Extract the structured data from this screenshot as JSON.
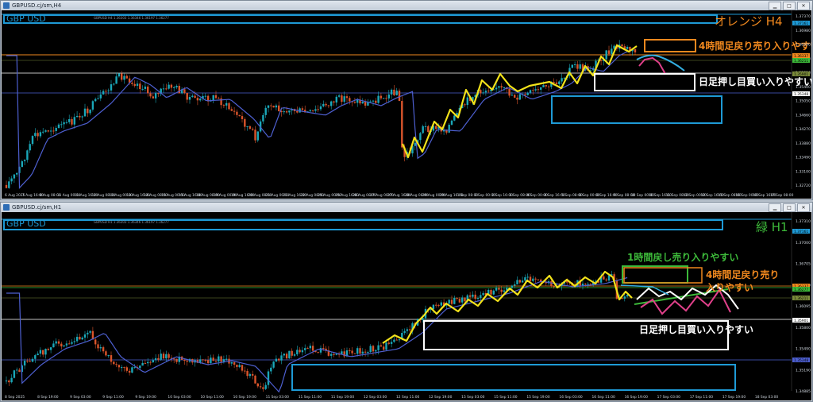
{
  "top": {
    "window_title": "GBPUSD.cj/sm,H4",
    "symbol_label": "GBP USD",
    "tf_label": "オレンジ H4",
    "header_info": "GBPUSD H4 1.36303 1.36346 1.36197 1.36277",
    "annotations": {
      "sell_text": "4時間足戻り売り入りやすい",
      "buy_text": "日足押し目買い入りやすい"
    },
    "prices": [
      "1.37370",
      "1.36980",
      "1.36590",
      "1.36200",
      "1.35810",
      "1.35400",
      "1.35050",
      "1.34660",
      "1.34270",
      "1.33880",
      "1.33490",
      "1.33100",
      "1.32720"
    ],
    "price_badges": [
      "1.37161",
      "1.36337",
      "1.36211",
      "1.35901",
      "1.35348"
    ],
    "times": [
      "6 Aug 2025",
      "7 Aug 16:00",
      "8 Aug 08:00",
      "11 Aug 00:00",
      "11 Aug 16:00",
      "12 Aug 08:00",
      "13 Aug 00:00",
      "13 Aug 16:00",
      "14 Aug 08:00",
      "15 Aug 00:00",
      "15 Aug 16:00",
      "18 Aug 08:00",
      "19 Aug 00:00",
      "19 Aug 16:00",
      "20 Aug 08:00",
      "21 Aug 00:00",
      "21 Aug 16:00",
      "22 Aug 08:00",
      "25 Aug 00:00",
      "25 Aug 16:00",
      "26 Aug 08:00",
      "27 Aug 00:00",
      "27 Aug 16:00",
      "28 Aug 08:00",
      "29 Aug 00:00",
      "29 Aug 16:00",
      "1 Sep 08:00",
      "2 Sep 00:00",
      "2 Sep 16:00",
      "3 Sep 08:00",
      "4 Sep 00:00",
      "4 Sep 16:00",
      "5 Sep 08:00",
      "8 Sep 00:00",
      "8 Sep 16:00",
      "9 Sep 08:00",
      "10 Sep 00:00",
      "10 Sep 16:00",
      "11 Sep 08:00",
      "12 Sep 00:00",
      "12 Sep 16:00",
      "15 Sep 08:00",
      "16 Sep 00:00",
      "16 Sep 16:00",
      "17 Sep 08:00"
    ]
  },
  "bottom": {
    "window_title": "GBPUSD.cj/sm,H1",
    "symbol_label": "GBP USD",
    "tf_label": "緑 H1",
    "header_info": "GBPUSD H1 1.36303 1.36346 1.36197 1.36277",
    "annotations": {
      "sell_h1_text": "1時間戻し売り入りやすい",
      "sell_h4_text_line1": "4時間足戻り売り",
      "sell_h4_text_line2": "入りやすい",
      "buy_text": "日足押し目買い入りやすい"
    },
    "prices": [
      "1.37310",
      "1.37000",
      "1.36705",
      "1.36400",
      "1.36095",
      "1.35800",
      "1.35490",
      "1.35190",
      "1.34885"
    ],
    "price_badges": [
      "1.37161",
      "1.36337",
      "1.36277",
      "1.36211",
      "1.35901",
      "1.35348"
    ],
    "times": [
      "8 Sep 2025",
      "8 Sep 19:00",
      "9 Sep 03:00",
      "9 Sep 11:00",
      "9 Sep 19:00",
      "10 Sep 03:00",
      "10 Sep 11:00",
      "10 Sep 19:00",
      "11 Sep 03:00",
      "11 Sep 11:00",
      "11 Sep 19:00",
      "12 Sep 03:00",
      "12 Sep 11:00",
      "12 Sep 19:00",
      "15 Sep 03:00",
      "15 Sep 11:00",
      "15 Sep 19:00",
      "16 Sep 03:00",
      "16 Sep 11:00",
      "16 Sep 19:00",
      "17 Sep 03:00",
      "17 Sep 11:00",
      "17 Sep 19:00",
      "18 Sep 03:00"
    ]
  },
  "colors": {
    "bull": "#1aa7b8",
    "bear": "#d9542b",
    "ma": "#4d5fd0",
    "zigzag": "#f2e21a",
    "blue_box": "#1e9ad6",
    "orange": "#f0881e",
    "green": "#3dba3a",
    "white": "#ffffff",
    "pink": "#e0408a",
    "sky": "#33aee0"
  }
}
